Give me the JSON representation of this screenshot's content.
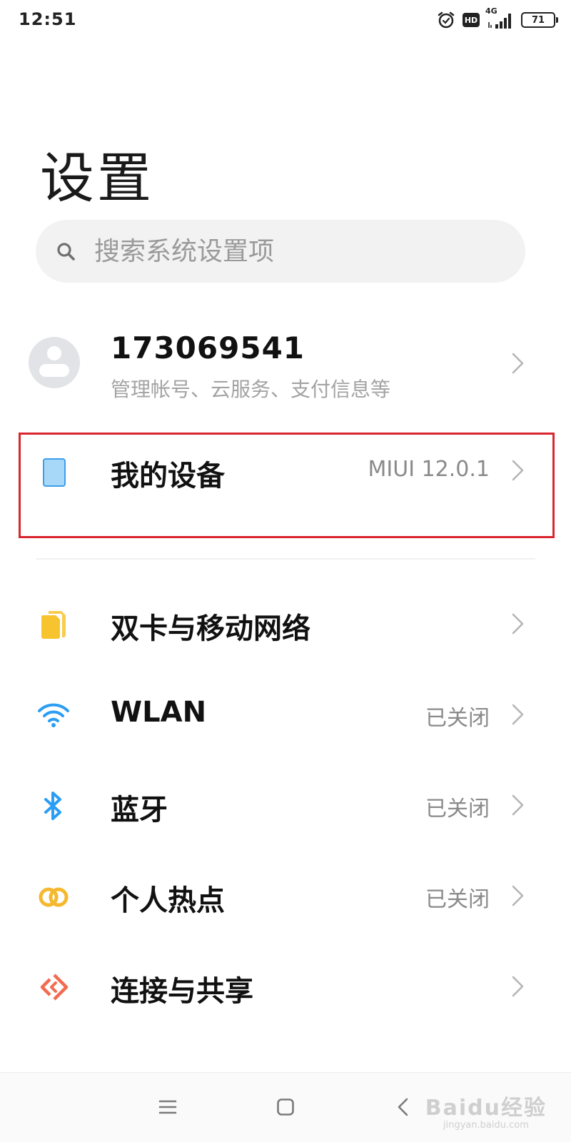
{
  "status_bar": {
    "time": "12:51",
    "hd": "HD",
    "network": "4G",
    "battery": "71"
  },
  "page": {
    "title": "设置"
  },
  "search": {
    "placeholder": "搜索系统设置项"
  },
  "account": {
    "id": "173069541",
    "subtitle": "管理帐号、云服务、支付信息等"
  },
  "device": {
    "label": "我的设备",
    "value": "MIUI 12.0.1"
  },
  "items": [
    {
      "label": "双卡与移动网络",
      "value": "",
      "icon": "sim-card-icon",
      "color": "#f7c32e"
    },
    {
      "label": "WLAN",
      "value": "已关闭",
      "icon": "wifi-icon",
      "color": "#2a9df4"
    },
    {
      "label": "蓝牙",
      "value": "已关闭",
      "icon": "bluetooth-icon",
      "color": "#2a9df4"
    },
    {
      "label": "个人热点",
      "value": "已关闭",
      "icon": "hotspot-icon",
      "color": "#f5b82e"
    },
    {
      "label": "连接与共享",
      "value": "",
      "icon": "connection-sharing-icon",
      "color": "#f26b4f"
    }
  ],
  "highlight_color": "#d9262f",
  "watermark": {
    "main": "Baidu经验",
    "sub": "jingyan.baidu.com"
  }
}
